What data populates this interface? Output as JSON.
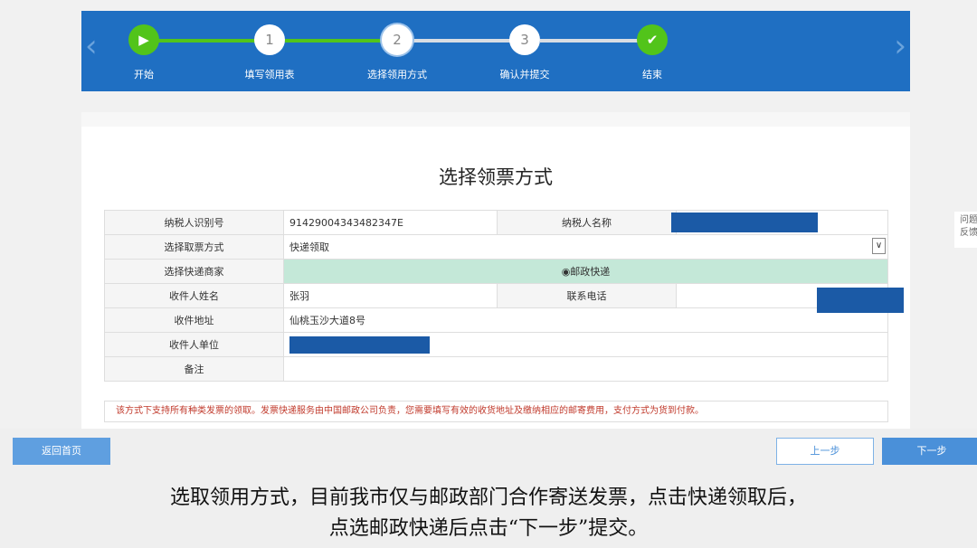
{
  "stepper": {
    "steps": [
      {
        "label": "开始",
        "marker": "▶",
        "state": "done"
      },
      {
        "label": "填写领用表",
        "marker": "1",
        "state": "done"
      },
      {
        "label": "选择领用方式",
        "marker": "2",
        "state": "current"
      },
      {
        "label": "确认并提交",
        "marker": "3",
        "state": "pending"
      },
      {
        "label": "结束",
        "marker": "✔",
        "state": "done"
      }
    ],
    "colors": {
      "banner": "#1f6fc2",
      "done": "#52c41a",
      "pending": "#d8dde3"
    }
  },
  "page": {
    "title": "选择领票方式"
  },
  "form": {
    "taxpayer_id_label": "纳税人识别号",
    "taxpayer_id_value": "91429004343482347E",
    "taxpayer_name_label": "纳税人名称",
    "pickup_method_label": "选择取票方式",
    "pickup_method_value": "快递领取",
    "courier_label": "选择快递商家",
    "courier_option": "邮政快递",
    "recipient_name_label": "收件人姓名",
    "recipient_name_value": "张羽",
    "phone_label": "联系电话",
    "address_label": "收件地址",
    "address_value": "仙桃玉沙大道8号",
    "recipient_unit_label": "收件人单位",
    "remark_label": "备注",
    "remark_value": ""
  },
  "notice": "该方式下支持所有种类发票的领取。发票快递服务由中国邮政公司负责，您需要填写有效的收货地址及缴纳相应的邮寄费用，支付方式为货到付款。",
  "side_text": "问题\n反馈",
  "buttons": {
    "home": "返回首页",
    "prev": "上一步",
    "next": "下一步"
  },
  "subtitles": {
    "line1": "选取领用方式，目前我市仅与邮政部门合作寄送发票，点击快递领取后，",
    "line2": "点选邮政快递后点击“下一步”提交。"
  }
}
